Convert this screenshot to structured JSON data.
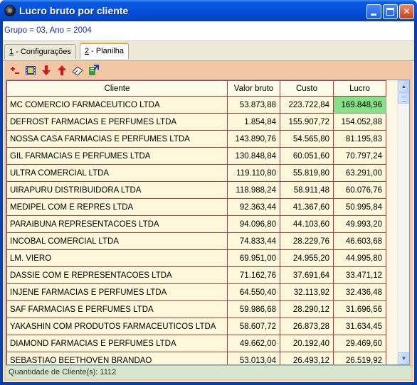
{
  "window": {
    "title": "Lucro bruto por cliente",
    "buttons": {
      "minimize": "",
      "maximize": "",
      "close": "✕"
    }
  },
  "filter": {
    "text": "Grupo = 03,  Ano = 2004"
  },
  "tabs": [
    {
      "key": "1",
      "label": " - Configurações"
    },
    {
      "key": "2",
      "label": " - Planilha"
    }
  ],
  "toolbar": {
    "icons": [
      "add-remove-icon",
      "film-icon",
      "arrow-down-icon",
      "arrow-up-icon",
      "eraser-icon",
      "export-icon"
    ]
  },
  "table": {
    "columns": [
      "Cliente",
      "Valor bruto",
      "Custo",
      "Lucro"
    ],
    "rows": [
      [
        "MC COMERCIO FARMACEUTICO LTDA",
        "53.873,88",
        "223.722,84",
        "169.848,96"
      ],
      [
        "DEFROST FARMACIAS E PERFUMES LTDA",
        "1.854,84",
        "155.907,72",
        "154.052,88"
      ],
      [
        "NOSSA CASA FARMACIAS E PERFUMES LTDA",
        "143.890,76",
        "54.565,80",
        "81.195,83"
      ],
      [
        "GIL FARMACIAS E PERFUMES LTDA",
        "130.848,84",
        "60.051,60",
        "70.797,24"
      ],
      [
        "ULTRA COMERCIAL LTDA",
        "119.110,80",
        "55.819,80",
        "63.291,00"
      ],
      [
        "UIRAPURU DISTRIBUIDORA LTDA",
        "118.988,24",
        "58.911,48",
        "60.076,76"
      ],
      [
        "MEDIPEL COM E REPRES LTDA",
        "92.363,44",
        "41.367,60",
        "50.995,84"
      ],
      [
        "PARAIBUNA REPRESENTACOES LTDA",
        "94.096,80",
        "44.103,60",
        "49.993,20"
      ],
      [
        "INCOBAL COMERCIAL LTDA",
        "74.833,44",
        "28.229,76",
        "46.603,68"
      ],
      [
        "LM. VIERO",
        "69.951,00",
        "24.955,20",
        "44.995,80"
      ],
      [
        "DASSIE COM E REPRESENTACOES LTDA",
        "71.162,76",
        "37.691,64",
        "33.471,12"
      ],
      [
        "INJENE FARMACIAS E PERFUMES LTDA",
        "64.550,40",
        "32.113,92",
        "32.436,48"
      ],
      [
        "SAF FARMACIAS E PERFUMES LTDA",
        "59.986,68",
        "28.290,12",
        "31.696,56"
      ],
      [
        "YAKASHIN COM PRODUTOS FARMACEUTICOS LTDA",
        "58.607,72",
        "26.873,28",
        "31.634,45"
      ],
      [
        "DIAMOND FARMACIAS E PERFUMES LTDA",
        "49.662,00",
        "20.192,40",
        "29.469,60"
      ],
      [
        "SEBASTIAO BEETHOVEN BRANDAO",
        "53.013,04",
        "26.493,12",
        "26.519,92"
      ]
    ],
    "highlight_color": "#86e086"
  },
  "status": {
    "text": "Quantidade de Cliente(s):  1112"
  },
  "colors": {
    "titlebar": "#0550dc",
    "panel": "#f2c7a6",
    "grid_border": "#c0343c",
    "filter_text": "#1a2cb8"
  }
}
